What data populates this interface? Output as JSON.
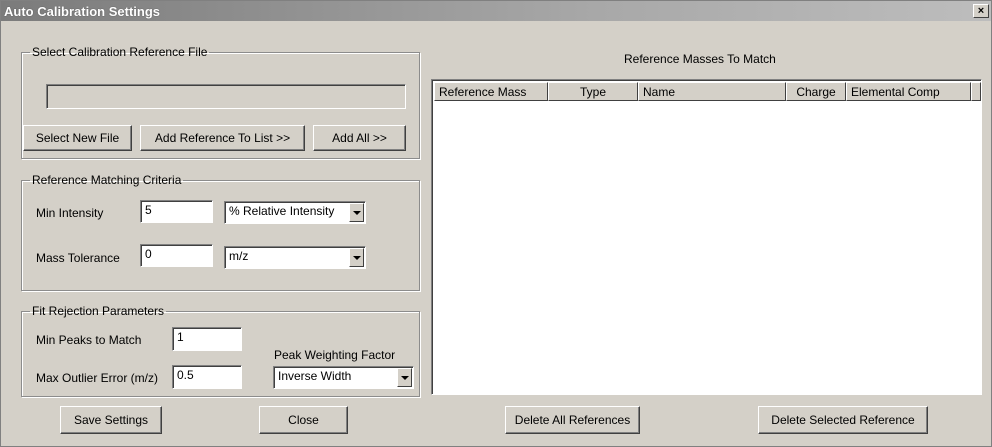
{
  "window": {
    "title": "Auto Calibration Settings",
    "close_glyph": "×",
    "close_icon": "close-icon"
  },
  "select_file": {
    "legend": "Select Calibration Reference File",
    "file_path": "",
    "buttons": {
      "select_new": "Select New File",
      "add_to_list": "Add Reference To List >>",
      "add_all": "Add All >>"
    }
  },
  "matching": {
    "legend": "Reference Matching Criteria",
    "min_intensity_label": "Min Intensity",
    "min_intensity_value": "5",
    "min_intensity_unit": "% Relative Intensity",
    "mass_tolerance_label": "Mass Tolerance",
    "mass_tolerance_value": "0",
    "mass_tolerance_unit": "m/z"
  },
  "fit_rejection": {
    "legend": "Fit Rejection Parameters",
    "min_peaks_label": "Min Peaks to Match",
    "min_peaks_value": "1",
    "max_outlier_label": "Max Outlier Error (m/z)",
    "max_outlier_value": "0.5",
    "weighting_label": "Peak Weighting Factor",
    "weighting_value": "Inverse Width"
  },
  "reference_list": {
    "title": "Reference Masses To Match",
    "columns": [
      "Reference Mass",
      "Type",
      "Name",
      "Charge",
      "Elemental Comp"
    ],
    "rows": []
  },
  "footer": {
    "save": "Save Settings",
    "close": "Close",
    "delete_all": "Delete All References",
    "delete_selected": "Delete Selected Reference"
  }
}
